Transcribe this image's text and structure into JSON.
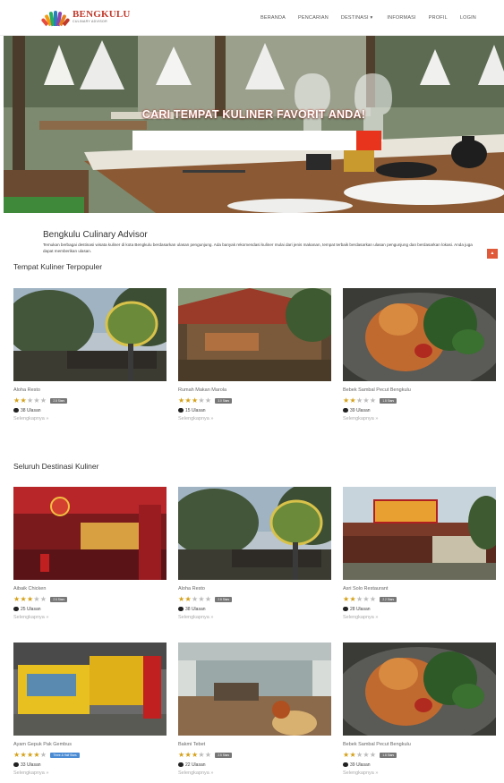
{
  "navbar": {
    "logo_title": "BENGKULU",
    "logo_subtitle": "CULINARY ADVISOR",
    "items": [
      {
        "label": "BERANDA"
      },
      {
        "label": "PENCARIAN"
      },
      {
        "label": "DESTINASI ▾"
      },
      {
        "label": "INFORMASI"
      },
      {
        "label": "PROFIL"
      },
      {
        "label": "LOGIN"
      }
    ]
  },
  "hero": {
    "title": "CARI TEMPAT KULINER FAVORIT ANDA!",
    "search_value": "",
    "search_icon": "search-icon",
    "accent": "#e8341c"
  },
  "intro": {
    "title": "Bengkulu Culinary Advisor",
    "text": "Temukan berbagai destinasi wisata kuliner di kota Bengkulu berdasarkan ulasan pengunjung. Ada banyak rekomendasi kuliner mulai dari jenis makanan, tempat terbaik berdasarkan ulasan pengunjung dan berdasarkan lokasi. Anda juga dapat memberikan ulasan."
  },
  "popular": {
    "title": "Tempat Kuliner Terpopuler",
    "cards": [
      {
        "name": "Aloha Resto",
        "rating": 2,
        "badge": "2.8 Stars",
        "reviews": "38 Ulasan",
        "more": "Selengkapnya »"
      },
      {
        "name": "Rumah Makan Marola",
        "rating": 3,
        "badge": "3.0 Stars",
        "reviews": "15 Ulasan",
        "more": "Selengkapnya »"
      },
      {
        "name": "Bebek Sambal Pecut Bengkulu",
        "rating": 2,
        "badge": "1.8 Stars",
        "reviews": "39 Ulasan",
        "more": "Selengkapnya »"
      }
    ]
  },
  "all": {
    "title": "Seluruh Destinasi Kuliner",
    "cards": [
      {
        "name": "Aibaik Chicken",
        "rating": 3,
        "badge": "2.6 Stars",
        "reviews": "25 Ulasan",
        "more": "Selengkapnya »"
      },
      {
        "name": "Aloha Resto",
        "rating": 2,
        "badge": "2.8 Stars",
        "reviews": "38 Ulasan",
        "more": "Selengkapnya »"
      },
      {
        "name": "Asri Solo Restaurant",
        "rating": 2,
        "badge": "2.2 Stars",
        "reviews": "28 Ulasan",
        "more": "Selengkapnya »"
      },
      {
        "name": "Ayam Gepuk Pak Gembus",
        "rating": 4,
        "badge": "Three & Half Stars",
        "reviews": "33 Ulasan",
        "more": "Selengkapnya »"
      },
      {
        "name": "Bakmi Tebet",
        "rating": 3,
        "badge": "2.5 Stars",
        "reviews": "22 Ulasan",
        "more": "Selengkapnya »"
      },
      {
        "name": "Bebek Sambal Pecut Bengkulu",
        "rating": 2,
        "badge": "1.8 Stars",
        "reviews": "39 Ulasan",
        "more": "Selengkapnya »"
      }
    ]
  },
  "colors": {
    "brand": "#c0392b",
    "star": "#d4a017",
    "star_off": "#bbbbbb",
    "badge": "#777777",
    "badge_alt": "#4a8bd4"
  }
}
